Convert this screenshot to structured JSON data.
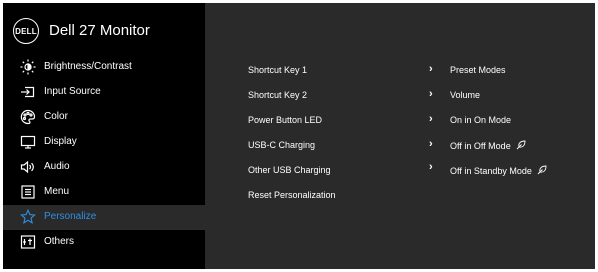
{
  "header": {
    "logo_text": "DELL",
    "title": "Dell 27 Monitor"
  },
  "sidebar": {
    "items": [
      {
        "label": "Brightness/Contrast",
        "icon": "brightness-icon"
      },
      {
        "label": "Input Source",
        "icon": "input-source-icon"
      },
      {
        "label": "Color",
        "icon": "color-palette-icon"
      },
      {
        "label": "Display",
        "icon": "display-icon"
      },
      {
        "label": "Audio",
        "icon": "speaker-icon"
      },
      {
        "label": "Menu",
        "icon": "menu-icon"
      },
      {
        "label": "Personalize",
        "icon": "star-icon",
        "selected": true
      },
      {
        "label": "Others",
        "icon": "others-icon"
      }
    ]
  },
  "main": {
    "rows": [
      {
        "label": "Shortcut Key 1",
        "value": "Preset Modes",
        "has_chevron": true
      },
      {
        "label": "Shortcut Key 2",
        "value": "Volume",
        "has_chevron": true
      },
      {
        "label": "Power Button LED",
        "value": "On in On Mode",
        "has_chevron": true
      },
      {
        "label": "USB-C Charging",
        "value": "Off in Off Mode",
        "has_chevron": true,
        "value_icon": "eco-leaf-icon"
      },
      {
        "label": "Other USB Charging",
        "value": "Off in Standby Mode",
        "has_chevron": true,
        "value_icon": "eco-leaf-icon"
      },
      {
        "label": "Reset Personalization",
        "value": "",
        "has_chevron": false
      }
    ],
    "chevron": "›"
  },
  "colors": {
    "accent": "#2f8fe0",
    "sidebar_bg": "#000000",
    "panel_bg": "#2a2a2a",
    "text": "#ffffff"
  }
}
